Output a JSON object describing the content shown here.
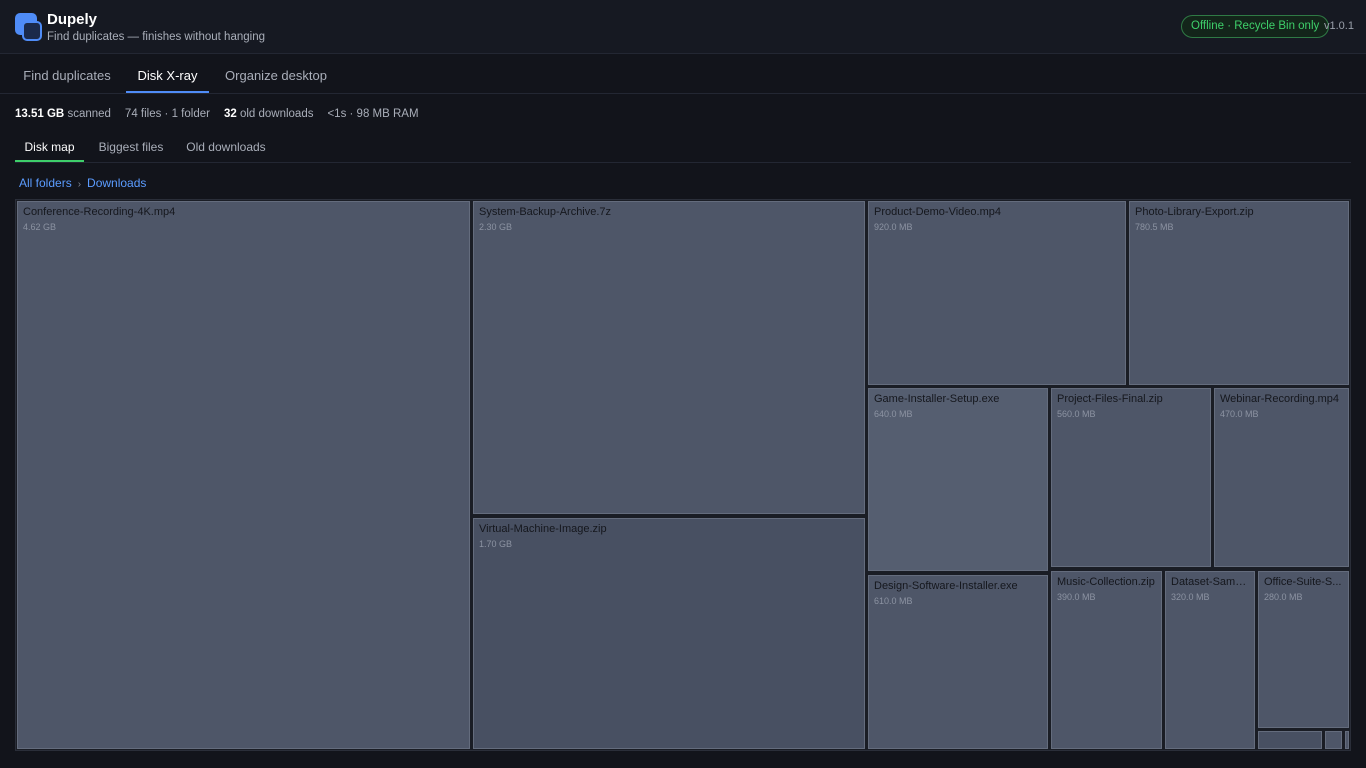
{
  "app": {
    "title": "Dupely",
    "subtitle": "Find duplicates — finishes without hanging",
    "status_badge": "Offline · Recycle Bin only",
    "version": "v1.0.1",
    "accent_color": "#4f8cf7",
    "status_color": "#3ecf6a"
  },
  "main_tabs": [
    {
      "label": "Find duplicates",
      "active": false
    },
    {
      "label": "Disk X-ray",
      "active": true
    },
    {
      "label": "Organize desktop",
      "active": false
    }
  ],
  "stats": {
    "size_value": "13.51 GB",
    "size_label": "scanned",
    "files": "74 files · 1 folder",
    "old_downloads_value": "32",
    "old_downloads_label": "old downloads",
    "perf": "<1s · 98 MB RAM"
  },
  "sub_tabs": [
    {
      "label": "Disk map",
      "active": true
    },
    {
      "label": "Biggest files",
      "active": false
    },
    {
      "label": "Old downloads",
      "active": false
    }
  ],
  "breadcrumb": {
    "root": "All folders",
    "separator": "›",
    "current": "Downloads"
  },
  "treemap": {
    "tiles": [
      {
        "name": "Conference-Recording-4K.mp4",
        "size": "4.62 GB"
      },
      {
        "name": "System-Backup-Archive.7z",
        "size": "2.30 GB"
      },
      {
        "name": "Virtual-Machine-Image.zip",
        "size": "1.70 GB"
      },
      {
        "name": "Product-Demo-Video.mp4",
        "size": "920.0 MB"
      },
      {
        "name": "Photo-Library-Export.zip",
        "size": "780.5 MB"
      },
      {
        "name": "Game-Installer-Setup.exe",
        "size": "640.0 MB"
      },
      {
        "name": "Project-Files-Final.zip",
        "size": "560.0 MB"
      },
      {
        "name": "Webinar-Recording.mp4",
        "size": "470.0 MB"
      },
      {
        "name": "Design-Software-Installer.exe",
        "size": "610.0 MB"
      },
      {
        "name": "Music-Collection.zip",
        "size": "390.0 MB"
      },
      {
        "name": "Dataset-Samp...",
        "size": "320.0 MB"
      },
      {
        "name": "Office-Suite-S...",
        "size": "280.0 MB"
      }
    ]
  }
}
